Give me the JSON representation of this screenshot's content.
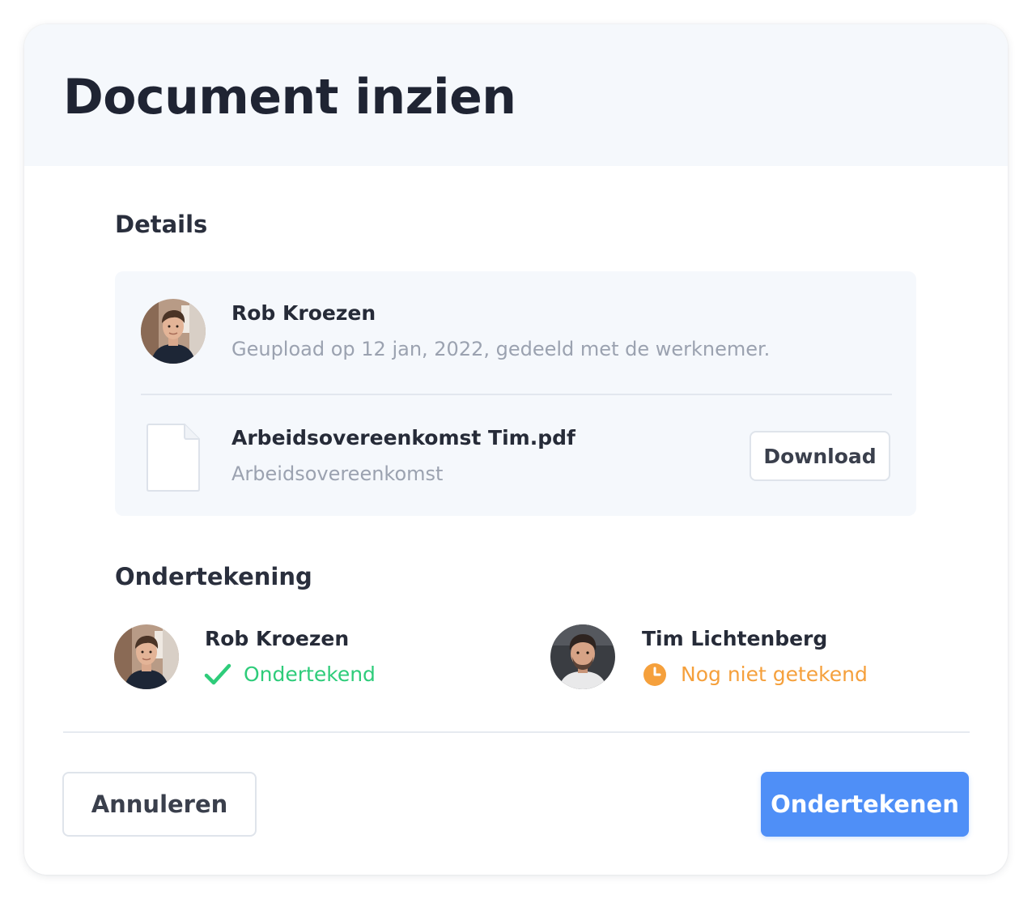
{
  "dialog": {
    "title": "Document inzien"
  },
  "details": {
    "section_title": "Details",
    "uploader": {
      "name": "Rob Kroezen",
      "meta": "Geupload op 12 jan, 2022, gedeeld met de werknemer.",
      "avatar_icon": "person-avatar"
    },
    "file": {
      "icon": "file-icon",
      "name": "Arbeidsovereenkomst Tim.pdf",
      "type": "Arbeidsovereenkomst",
      "download_label": "Download"
    }
  },
  "signing": {
    "section_title": "Ondertekening",
    "signers": [
      {
        "name": "Rob Kroezen",
        "status": "Ondertekend",
        "status_icon": "check-icon",
        "status_color": "#2ecc7a"
      },
      {
        "name": "Tim Lichtenberg",
        "status": "Nog niet getekend",
        "status_icon": "clock-icon",
        "status_color": "#f5a03c"
      }
    ]
  },
  "footer": {
    "cancel_label": "Annuleren",
    "sign_label": "Ondertekenen"
  },
  "colors": {
    "primary": "#4f8ff7",
    "success": "#2ecc7a",
    "warning": "#f5a03c",
    "header_bg": "#f5f8fc",
    "text_dark": "#1f2433",
    "text_muted": "#9ba2b0"
  }
}
